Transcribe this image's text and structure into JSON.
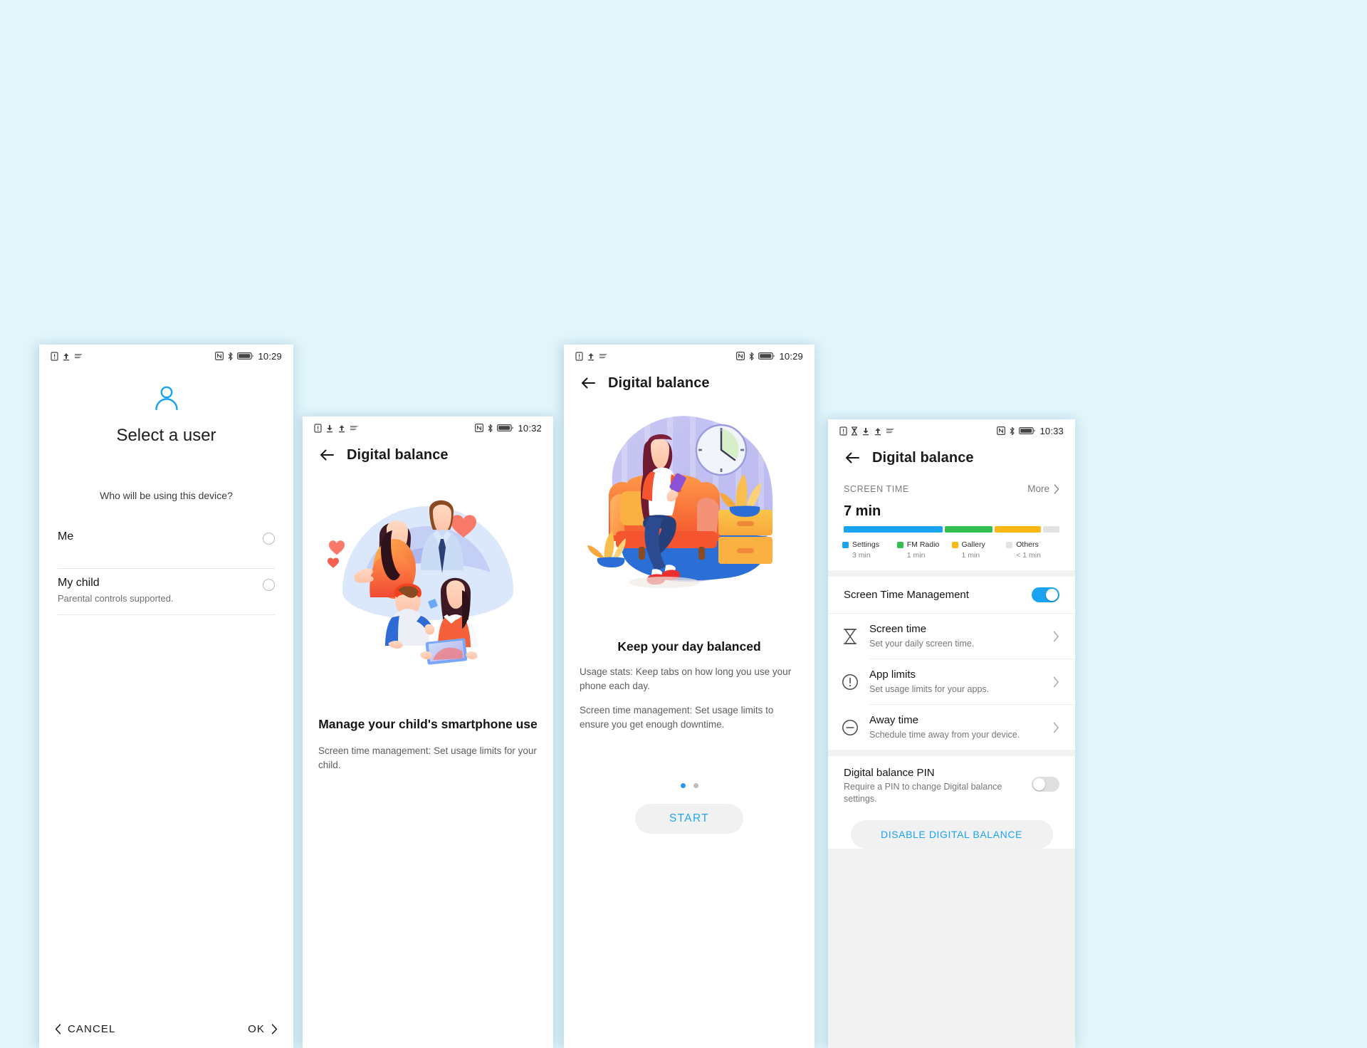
{
  "background_color": "#e2f5fb",
  "accent_blue": "#1aa3f0",
  "phone1": {
    "status": {
      "time": "10:29",
      "icons_left": [
        "sim-card-icon",
        "upload-arrow-icon",
        "data-saver-icon"
      ],
      "icons_right": [
        "nfc-icon",
        "bluetooth-icon",
        "battery-icon"
      ]
    },
    "user_icon": "person-icon",
    "title": "Select a user",
    "question": "Who will be using this device?",
    "options": [
      {
        "label": "Me",
        "sublabel": "",
        "selected": false
      },
      {
        "label": "My child",
        "sublabel": "Parental controls supported.",
        "selected": false
      }
    ],
    "cancel_label": "CANCEL",
    "ok_label": "OK"
  },
  "phone2": {
    "status": {
      "time": "10:32",
      "icons_left": [
        "sim-card-icon",
        "download-arrow-icon",
        "upload-arrow-icon",
        "data-saver-icon"
      ],
      "icons_right": [
        "nfc-icon",
        "bluetooth-icon",
        "battery-icon"
      ]
    },
    "appbar": {
      "back_icon": "back-arrow-icon",
      "title": "Digital balance"
    },
    "illustration": "family-with-devices-illustration",
    "heading": "Manage your child's smartphone use",
    "body": "Screen time management: Set usage limits for your child."
  },
  "phone3": {
    "status": {
      "time": "10:29",
      "icons_left": [
        "sim-card-icon",
        "upload-arrow-icon",
        "data-saver-icon"
      ],
      "icons_right": [
        "nfc-icon",
        "bluetooth-icon",
        "battery-icon"
      ]
    },
    "appbar": {
      "back_icon": "back-arrow-icon",
      "title": "Digital balance"
    },
    "illustration": "woman-on-couch-with-clock-illustration",
    "heading": "Keep your day balanced",
    "body1": "Usage stats: Keep tabs on how long you use your phone each day.",
    "body2": "Screen time management: Set usage limits to ensure you get enough downtime.",
    "pager": {
      "total": 2,
      "active_index": 0
    },
    "start_label": "START"
  },
  "phone4": {
    "status": {
      "time": "10:33",
      "icons_left": [
        "sim-card-icon",
        "hourglass-icon",
        "download-arrow-icon",
        "upload-arrow-icon",
        "data-saver-icon"
      ],
      "icons_right": [
        "nfc-icon",
        "bluetooth-icon",
        "battery-icon"
      ]
    },
    "appbar": {
      "back_icon": "back-arrow-icon",
      "title": "Digital balance"
    },
    "screen_time": {
      "section_label": "SCREEN TIME",
      "more_label": "More",
      "more_icon": "chevron-right-icon",
      "total": "7 min",
      "breakdown": [
        {
          "name": "Settings",
          "value": "3 min",
          "color": "#1aa3f0",
          "pct": 49
        },
        {
          "name": "FM Radio",
          "value": "1 min",
          "color": "#32c050",
          "pct": 24
        },
        {
          "name": "Gallery",
          "value": "1 min",
          "color": "#fbb713",
          "pct": 23
        },
        {
          "name": "Others",
          "value": "< 1 min",
          "color": "#e3e3e3",
          "pct": 8
        }
      ]
    },
    "management_toggle": {
      "label": "Screen Time Management",
      "on": true
    },
    "items": [
      {
        "icon": "hourglass-icon",
        "title": "Screen time",
        "subtitle": "Set your daily screen time.",
        "chevron": "chevron-right-icon"
      },
      {
        "icon": "exclamation-circle-icon",
        "title": "App limits",
        "subtitle": "Set usage limits for your apps.",
        "chevron": "chevron-right-icon"
      },
      {
        "icon": "minus-circle-icon",
        "title": "Away time",
        "subtitle": "Schedule time away from your device.",
        "chevron": "chevron-right-icon"
      }
    ],
    "pin": {
      "title": "Digital balance PIN",
      "subtitle": "Require a PIN to change Digital balance settings.",
      "on": false
    },
    "disable_label": "DISABLE DIGITAL BALANCE"
  }
}
